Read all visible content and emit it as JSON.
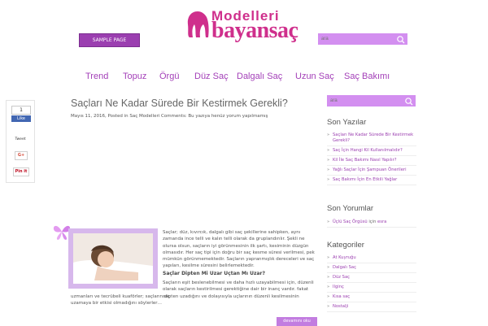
{
  "logo": {
    "top_text": "Modelleri",
    "main_text": "bayansaç"
  },
  "header": {
    "sample_page_label": "SAMPLE PAGE",
    "search_placeholder": "ara"
  },
  "nav": {
    "items": [
      "Trend",
      "Topuz",
      "Örgü",
      "Düz Saç",
      "Dalgalı Saç",
      "Uzun Saç",
      "Saç Bakımı"
    ]
  },
  "social": {
    "fb_count": "1",
    "fb_like": "Like",
    "tweet": "Tweet",
    "gplus": "G+",
    "pinit": "Pin it"
  },
  "post": {
    "title": "Saçları Ne Kadar Sürede Bir Kestirmek Gerekli?",
    "meta": "Mayıs 11, 2016, Posted in  Saç Modelleri Comments: Bu yazıya henüz yorum yapılmamış",
    "excerpt": "Saçlar; düz, kıvırcık, dalgalı gibi saç şekillerine sahipken, aynı zamanda ince telli ve kalın telli olarak da gruplandırılır. Şekli ne olursa olsun, saçların iyi görünmesinin ilk şartı, kesiminin düzgün olmasıdır. Her saç tipi için doğru bir saç kesme süresi verilmesi, pek mümkün görünmemektedir. Saçların yapranmışlık dereceleri ve saç yapıları, kesilme süresini belirlemektedir.",
    "subheading": "Saçlar Dipten Mi Uzar Uçtan Mı Uzar?",
    "excerpt2": "Saçların eşit beslenebilmesi ve daha hızlı uzayabilmesi için, düzenli olarak saçların kestirilmesi gerektiğine dair bir inanç vardır. fakat saç",
    "excerpt3": "uzmanları ve tecrübeli kuaförler; saçların dipten uzadığını ve dolayısıyla uçlarının düzenli kesilmesinin uzamaya bir etkisi olmadığını söylerler…",
    "read_more": "devamını oku"
  },
  "sidebar": {
    "search_placeholder": "ara",
    "recent_posts_title": "Son Yazılar",
    "recent_posts": [
      "Saçları Ne Kadar Sürede Bir Kestirmek Gerekli?",
      "Saç İçin Hangi Kil Kullanılmalıdır?",
      "Kil İle Saç Bakımı Nasıl Yapılır?",
      "Yağlı Saçlar İçin Şampuan Önerileri",
      "Saç Bakımı İçin En Etkili Yağlar"
    ],
    "recent_comments_title": "Son Yorumlar",
    "recent_comment": {
      "post": "Üçlü Saç Örgüsü",
      "joiner": "için",
      "author": "esra"
    },
    "categories_title": "Kategoriler",
    "categories": [
      "At Kuyruğu",
      "Dalgalı Saç",
      "Düz Saç",
      "Kısa saç",
      "Nostalji"
    ],
    "categories_extra": "Ilginç"
  },
  "colors": {
    "brand": "#cf2f8c",
    "accent": "#9b3fb0",
    "search_bg": "#d38ff0"
  }
}
